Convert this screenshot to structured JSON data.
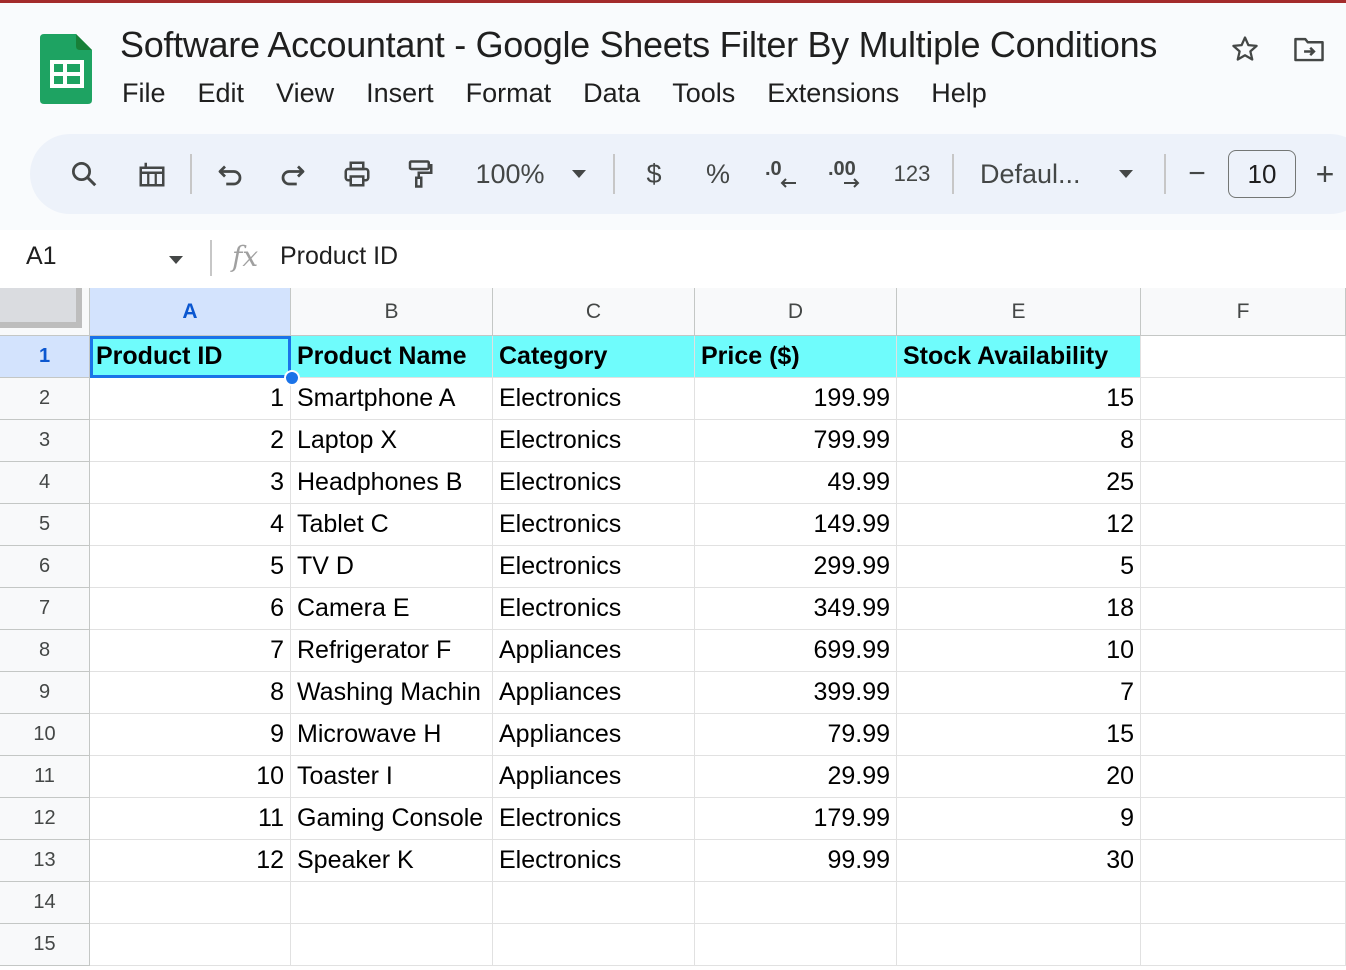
{
  "title": "Software Accountant - Google Sheets Filter By Multiple Conditions",
  "menu": [
    "File",
    "Edit",
    "View",
    "Insert",
    "Format",
    "Data",
    "Tools",
    "Extensions",
    "Help"
  ],
  "toolbar": {
    "zoom": "100%",
    "currency": "$",
    "percent": "%",
    "more_formats": "123",
    "font_family": "Defaul...",
    "font_size": "10",
    "decrease_font": "−",
    "increase_font": "+"
  },
  "formula_bar": {
    "name_box": "A1",
    "fx": "fx",
    "content": "Product ID"
  },
  "grid": {
    "columns": [
      "A",
      "B",
      "C",
      "D",
      "E",
      "F"
    ],
    "rows": [
      "1",
      "2",
      "3",
      "4",
      "5",
      "6",
      "7",
      "8",
      "9",
      "10",
      "11",
      "12",
      "13",
      "14",
      "15"
    ],
    "selected_cell": "A1",
    "cells": [
      [
        "Product ID",
        "Product Name",
        "Category",
        "Price ($)",
        "Stock Availability",
        ""
      ],
      [
        "1",
        "Smartphone A",
        "Electronics",
        "199.99",
        "15",
        ""
      ],
      [
        "2",
        "Laptop X",
        "Electronics",
        "799.99",
        "8",
        ""
      ],
      [
        "3",
        "Headphones B",
        "Electronics",
        "49.99",
        "25",
        ""
      ],
      [
        "4",
        "Tablet C",
        "Electronics",
        "149.99",
        "12",
        ""
      ],
      [
        "5",
        "TV D",
        "Electronics",
        "299.99",
        "5",
        ""
      ],
      [
        "6",
        "Camera E",
        "Electronics",
        "349.99",
        "18",
        ""
      ],
      [
        "7",
        "Refrigerator F",
        "Appliances",
        "699.99",
        "10",
        ""
      ],
      [
        "8",
        "Washing Machin",
        "Appliances",
        "399.99",
        "7",
        ""
      ],
      [
        "9",
        "Microwave H",
        "Appliances",
        "79.99",
        "15",
        ""
      ],
      [
        "10",
        "Toaster I",
        "Appliances",
        "29.99",
        "20",
        ""
      ],
      [
        "11",
        "Gaming Console",
        "Electronics",
        "179.99",
        "9",
        ""
      ],
      [
        "12",
        "Speaker K",
        "Electronics",
        "99.99",
        "30",
        ""
      ],
      [
        "",
        "",
        "",
        "",
        "",
        ""
      ],
      [
        "",
        "",
        "",
        "",
        "",
        ""
      ]
    ]
  },
  "colors": {
    "header_fill": "#6ffcfc",
    "selection": "#1a73e8",
    "sheets_green": "#1ea362"
  }
}
